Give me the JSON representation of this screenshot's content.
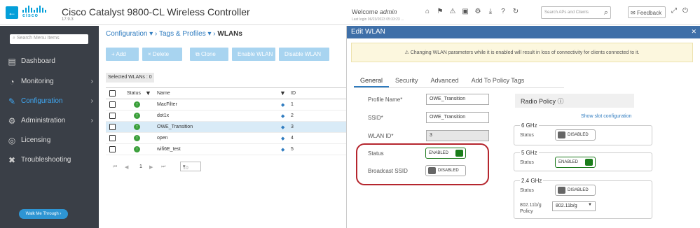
{
  "header": {
    "back_icon": "arrow-left-icon",
    "logo_text": "cisco",
    "title": "Cisco Catalyst 9800-CL Wireless Controller",
    "version": "17.9.3",
    "welcome_prefix": "Welcome",
    "welcome_user": "admin",
    "last_login": "Last login 06/23/2023 05:33:23 ...",
    "icons": [
      "home-icon",
      "wireless-icon",
      "alert-icon",
      "save-icon",
      "gear-icon",
      "download-icon",
      "help-icon",
      "refresh-icon"
    ],
    "search_placeholder": "Search APs and Clients",
    "feedback_label": "Feedback"
  },
  "sidebar": {
    "search_placeholder": "Search Menu Items",
    "items": [
      {
        "label": "Dashboard",
        "icon": "dashboard-icon",
        "has_children": false
      },
      {
        "label": "Monitoring",
        "icon": "monitoring-icon",
        "has_children": true
      },
      {
        "label": "Configuration",
        "icon": "wrench-icon",
        "has_children": true,
        "active": true
      },
      {
        "label": "Administration",
        "icon": "gear-icon",
        "has_children": true
      },
      {
        "label": "Licensing",
        "icon": "license-icon",
        "has_children": false
      },
      {
        "label": "Troubleshooting",
        "icon": "tools-icon",
        "has_children": false
      }
    ],
    "walk_me_label": "Walk Me Through ›"
  },
  "breadcrumb": {
    "items": [
      "Configuration",
      "Tags & Profiles"
    ],
    "current": "WLANs"
  },
  "toolbar": {
    "add": "+ Add",
    "delete": "× Delete",
    "clone": "Clone",
    "enable": "Enable WLAN",
    "disable": "Disable WLAN"
  },
  "selected_count": "Selected WLANs : 0",
  "table": {
    "headers": {
      "status": "Status",
      "name": "Name",
      "id": "ID"
    },
    "rows": [
      {
        "name": "MacFilter",
        "id": "1",
        "selected": false
      },
      {
        "name": "dot1x",
        "id": "2",
        "selected": false
      },
      {
        "name": "OWE_Transition",
        "id": "3",
        "selected": true
      },
      {
        "name": "open",
        "id": "4",
        "selected": false
      },
      {
        "name": "wifi6E_test",
        "id": "5",
        "selected": false
      }
    ],
    "pager": {
      "first": "⏮",
      "prev": "◀",
      "page": "1",
      "next": "▶",
      "last": "⏭",
      "page_size": "10"
    }
  },
  "edit": {
    "title": "Edit WLAN",
    "warning": "⚠ Changing WLAN parameters while it is enabled will result in loss of connectivity for clients connected to it.",
    "tabs": [
      "General",
      "Security",
      "Advanced",
      "Add To Policy Tags"
    ],
    "active_tab": "General",
    "profile_name_label": "Profile Name*",
    "profile_name": "OWE_Transition",
    "ssid_label": "SSID*",
    "ssid": "OWE_Transition",
    "wlan_id_label": "WLAN ID*",
    "wlan_id": "3",
    "status_label": "Status",
    "status_value": "ENABLED",
    "broadcast_label": "Broadcast SSID",
    "broadcast_value": "DISABLED",
    "radio_policy_label": "Radio Policy ⓘ",
    "slot_link": "Show slot configuration",
    "bands": [
      {
        "title": "6 GHz",
        "status_label": "Status",
        "status": "DISABLED"
      },
      {
        "title": "5 GHz",
        "status_label": "Status",
        "status": "ENABLED"
      },
      {
        "title": "2.4 GHz",
        "status_label": "Status",
        "status": "DISABLED",
        "policy_label": "802.11b/g Policy",
        "policy_value": "802.11b/g"
      }
    ]
  }
}
